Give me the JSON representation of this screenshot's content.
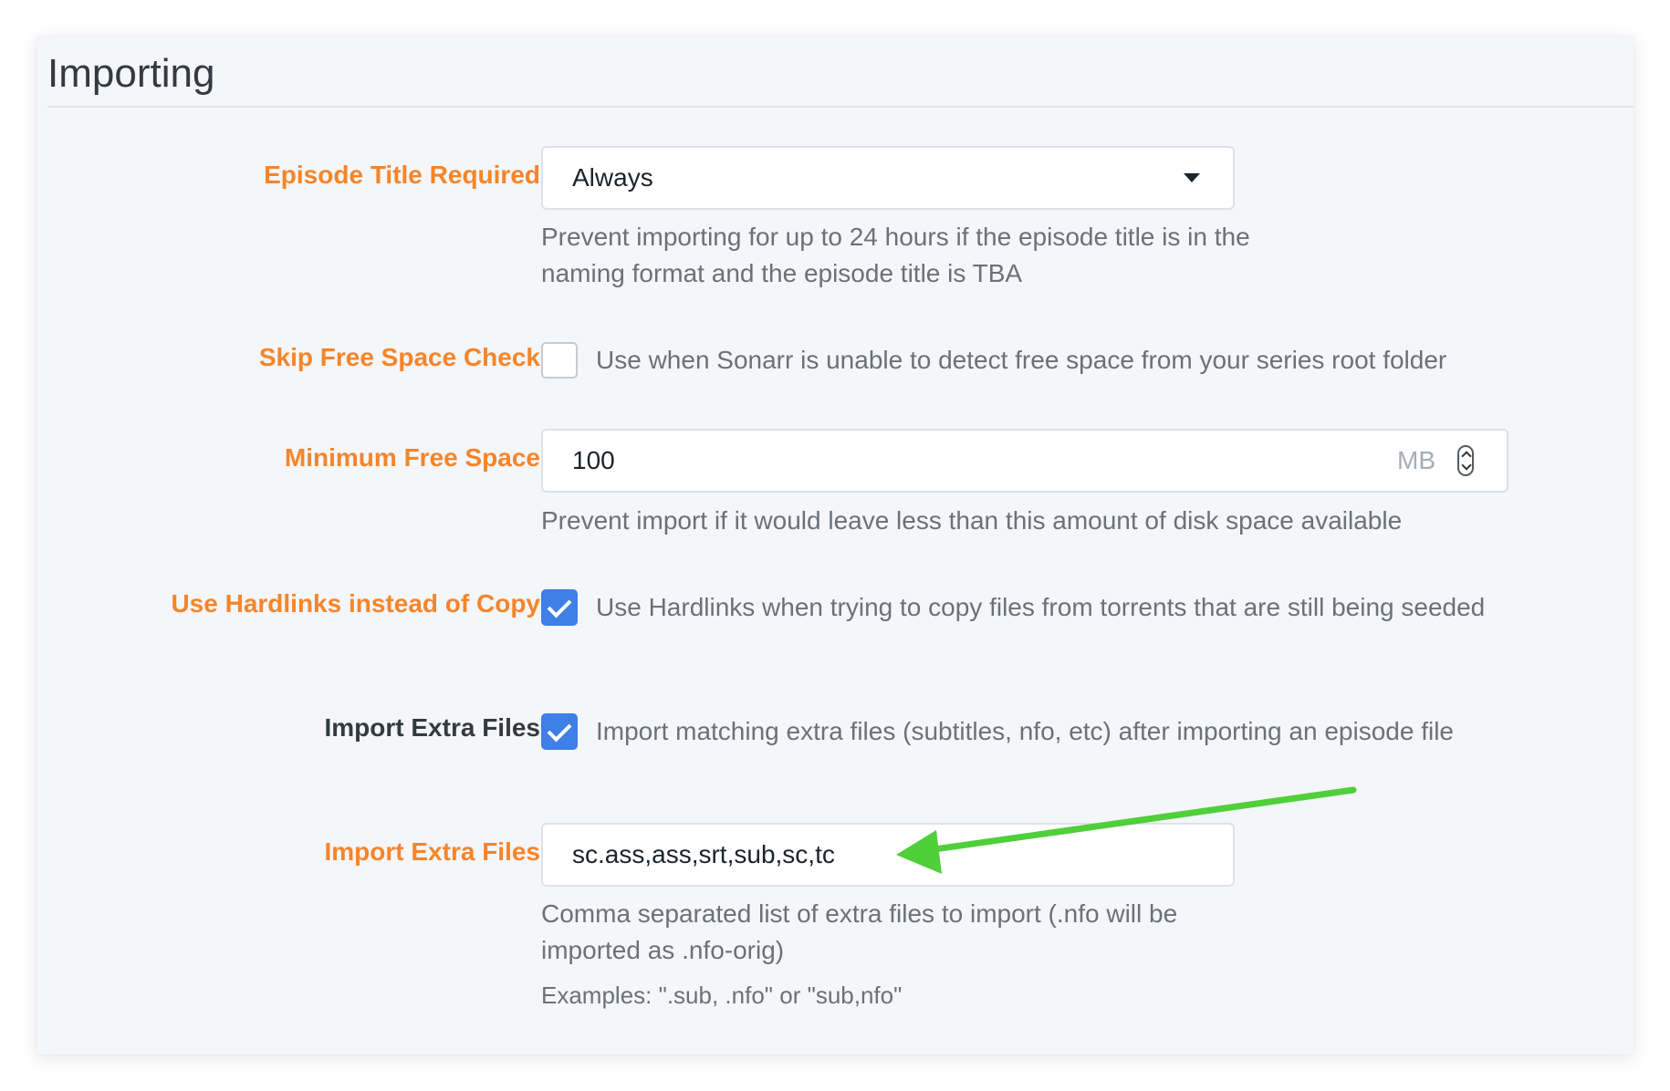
{
  "section": {
    "title": "Importing"
  },
  "episode_title_required": {
    "label": "Episode Title Required",
    "value": "Always",
    "help": "Prevent importing for up to 24 hours if the episode title is in the naming format and the episode title is TBA"
  },
  "skip_free_space_check": {
    "label": "Skip Free Space Check",
    "checked": false,
    "text": "Use when Sonarr is unable to detect free space from your series root folder"
  },
  "minimum_free_space": {
    "label": "Minimum Free Space",
    "value": "100",
    "unit": "MB",
    "help": "Prevent import if it would leave less than this amount of disk space available"
  },
  "use_hardlinks": {
    "label": "Use Hardlinks instead of Copy",
    "checked": true,
    "text": "Use Hardlinks when trying to copy files from torrents that are still being seeded"
  },
  "import_extra_files": {
    "label": "Import Extra Files",
    "checked": true,
    "text": "Import matching extra files (subtitles, nfo, etc) after importing an episode file"
  },
  "extra_file_extensions": {
    "label": "Import Extra Files",
    "value": "sc.ass,ass,srt,sub,sc,tc",
    "help": "Comma separated list of extra files to import (.nfo will be imported as .nfo-orig)",
    "examples": "Examples: \".sub, .nfo\" or \"sub,nfo\""
  },
  "colors": {
    "label_advanced": "#f5852a",
    "label_normal": "#333a42",
    "checkbox_on": "#3f7fe6",
    "annotation_arrow": "#4fcf3a"
  }
}
